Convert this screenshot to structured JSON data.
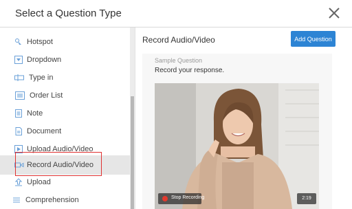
{
  "modal": {
    "title": "Select a Question Type",
    "close_icon": "close-icon"
  },
  "sidebar": {
    "items": [
      {
        "label": "Hotspot",
        "icon": "hotspot-icon"
      },
      {
        "label": "Dropdown",
        "icon": "dropdown-icon"
      },
      {
        "label": "Type in",
        "icon": "type-in-icon"
      },
      {
        "label": "Order List",
        "icon": "order-list-icon"
      },
      {
        "label": "Note",
        "icon": "note-icon"
      },
      {
        "label": "Document",
        "icon": "document-icon"
      },
      {
        "label": "Upload Audio/Video",
        "icon": "upload-video-icon"
      },
      {
        "label": "Record Audio/Video",
        "icon": "record-video-icon",
        "selected": true
      },
      {
        "label": "Upload",
        "icon": "upload-icon"
      },
      {
        "label": "Comprehension",
        "icon": "comprehension-icon"
      }
    ]
  },
  "main": {
    "title": "Record Audio/Video",
    "add_button": "Add Question",
    "sample_label": "Sample Question",
    "question": "Record your response.",
    "video": {
      "stop_label": "Stop Recording",
      "timer": "2:19"
    }
  },
  "colors": {
    "accent": "#2d84d4",
    "highlight": "#e03030",
    "recording": "#e23a2e"
  }
}
